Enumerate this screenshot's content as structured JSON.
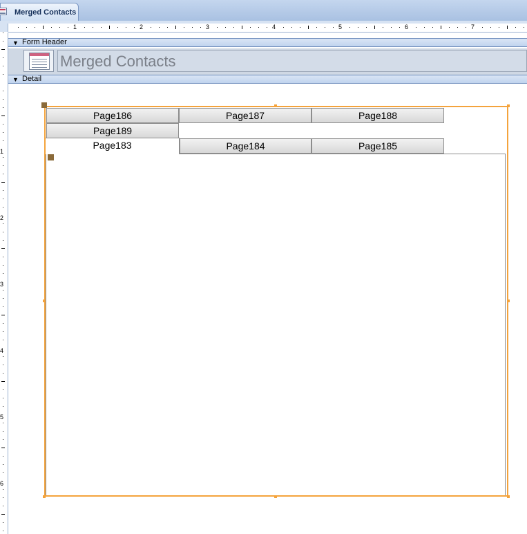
{
  "document_tab": {
    "title": "Merged Contacts",
    "icon": "form-icon"
  },
  "ruler": {
    "horizontal_numbers": [
      "1",
      "2",
      "3",
      "4",
      "5",
      "6",
      "7"
    ],
    "vertical_numbers": [
      "1",
      "2",
      "3",
      "4",
      "5",
      "6"
    ]
  },
  "sections": {
    "form_header_label": "Form Header",
    "detail_label": "Detail",
    "collapse_arrow": "▼"
  },
  "form_header": {
    "title": "Merged Contacts",
    "logo_icon": "form-logo-icon"
  },
  "tab_control": {
    "row1": [
      "Page186",
      "Page187",
      "Page188"
    ],
    "row2": [
      "Page189"
    ],
    "row3": [
      "Page183",
      "Page184",
      "Page185"
    ],
    "active_tab": "Page183",
    "selection_color": "#f4a33c"
  }
}
